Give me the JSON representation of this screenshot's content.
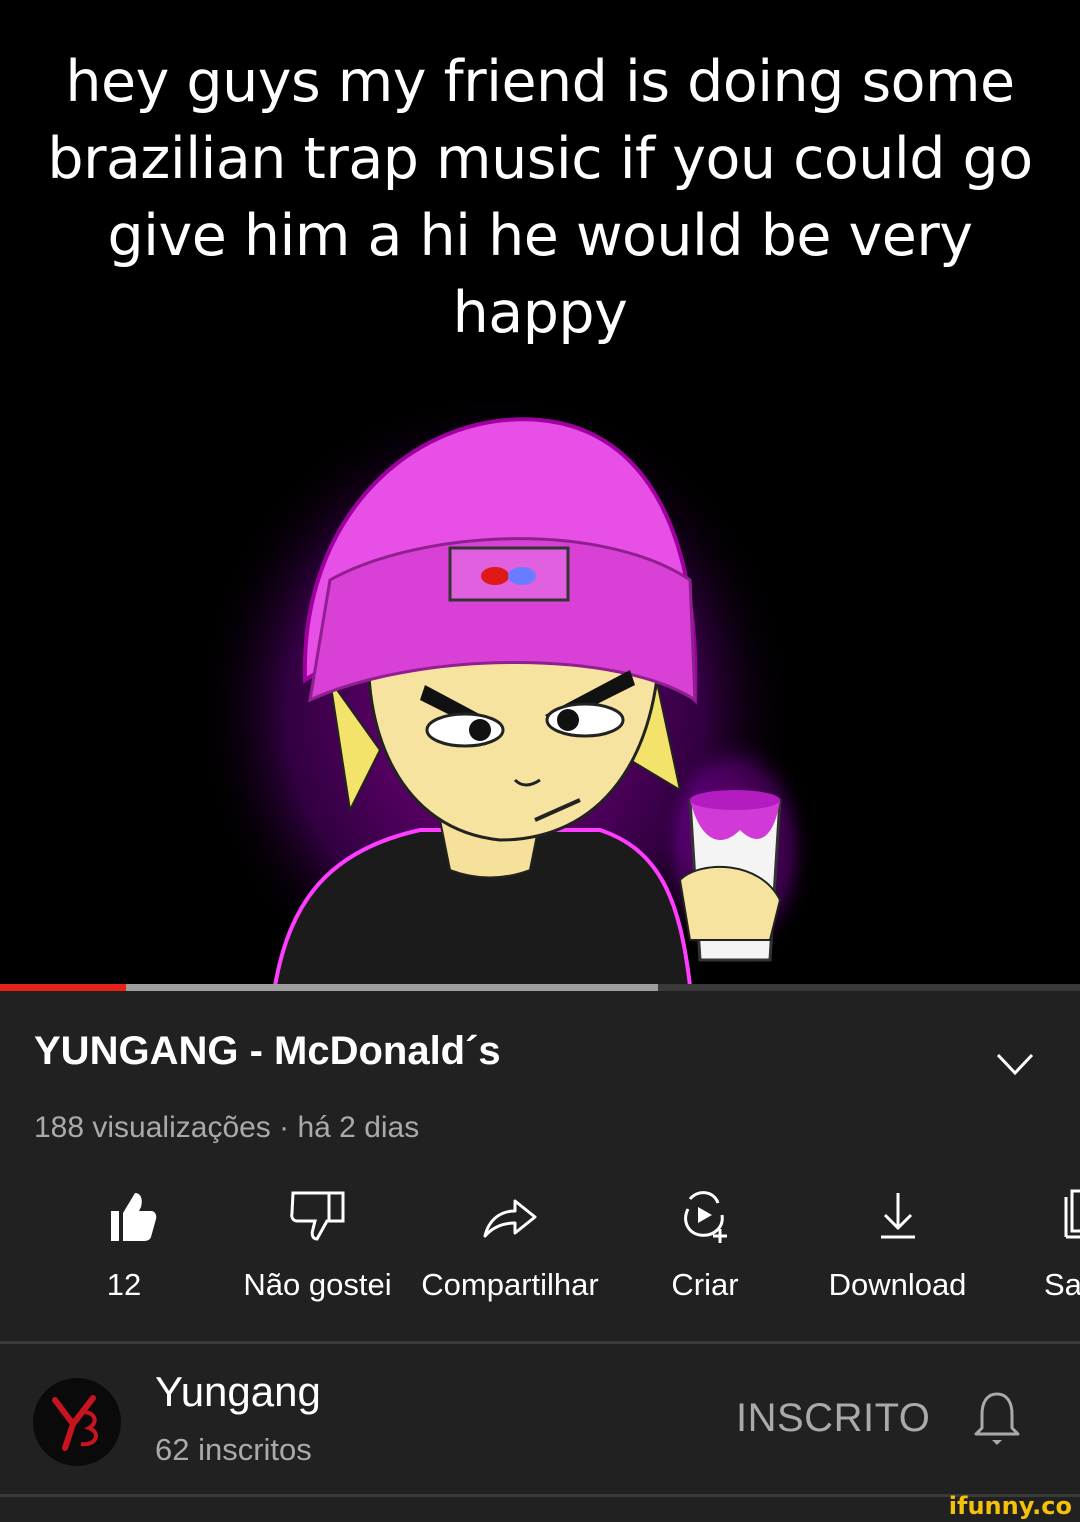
{
  "caption": "hey guys my friend is doing some brazilian trap music if you could go give him a hi he would be very happy",
  "player": {
    "progress_played": 0.117,
    "progress_buffered": 0.609,
    "progress_color": "#e62117"
  },
  "video": {
    "title": "YUNGANG - McDonald´s",
    "meta": "188 visualizações · há 2 dias"
  },
  "actions": [
    {
      "icon": "like-icon",
      "label": "12"
    },
    {
      "icon": "dislike-icon",
      "label": "Não gostei"
    },
    {
      "icon": "share-icon",
      "label": "Compartilhar"
    },
    {
      "icon": "create-icon",
      "label": "Criar"
    },
    {
      "icon": "download-icon",
      "label": "Download"
    },
    {
      "icon": "save-icon",
      "label": "Sa"
    }
  ],
  "channel": {
    "name": "Yungang",
    "subscribers": "62 inscritos",
    "subscribe_label": "INSCRITO"
  },
  "watermark": "ifunny.co"
}
